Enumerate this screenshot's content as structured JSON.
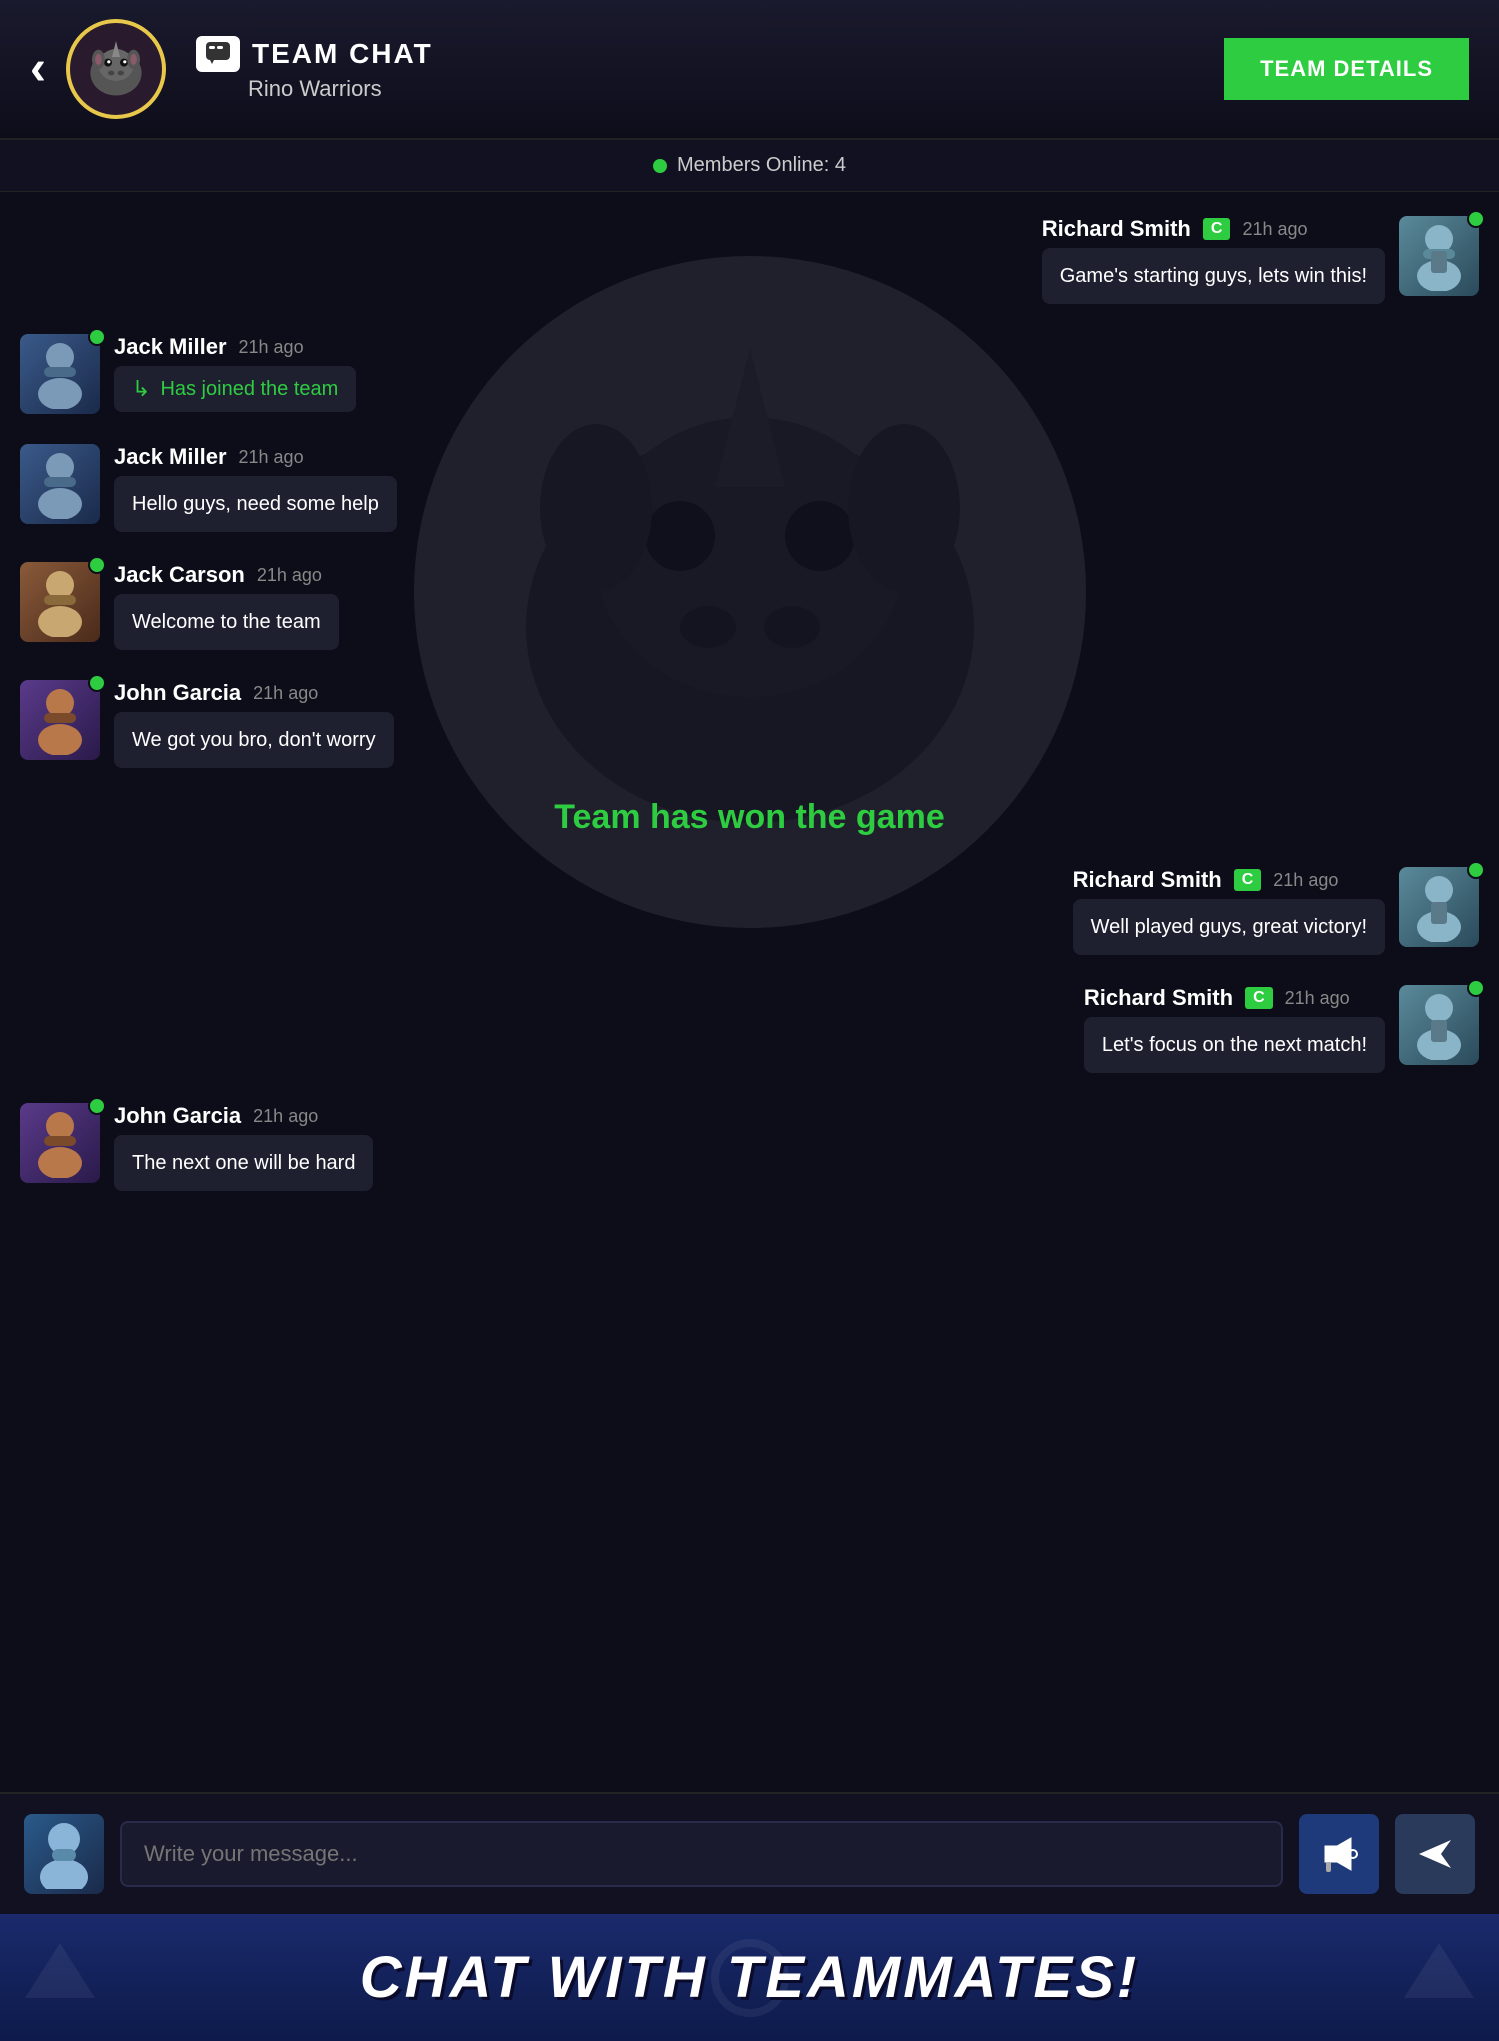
{
  "header": {
    "back_label": "‹",
    "chat_label": "TEAM CHAT",
    "team_name": "Rino Warriors",
    "team_details_label": "TEAM DETAILS"
  },
  "online_bar": {
    "label": "Members Online: 4"
  },
  "messages": [
    {
      "id": "msg1",
      "side": "right",
      "sender": "Richard Smith",
      "badge": "C",
      "time": "21h ago",
      "text": "Game's starting guys, lets win this!",
      "avatar_color": "av-richard",
      "online": true,
      "type": "normal"
    },
    {
      "id": "msg2",
      "side": "left",
      "sender": "Jack Miller",
      "badge": null,
      "time": "21h ago",
      "text": "Has joined the team",
      "avatar_color": "av-jack-miller",
      "online": true,
      "type": "join"
    },
    {
      "id": "msg3",
      "side": "left",
      "sender": "Jack Miller",
      "badge": null,
      "time": "21h ago",
      "text": "Hello guys, need some help",
      "avatar_color": "av-jack-miller",
      "online": false,
      "type": "normal"
    },
    {
      "id": "msg4",
      "side": "left",
      "sender": "Jack Carson",
      "badge": null,
      "time": "21h ago",
      "text": "Welcome to the team",
      "avatar_color": "av-jack-carson",
      "online": true,
      "type": "normal"
    },
    {
      "id": "msg5",
      "side": "left",
      "sender": "John Garcia",
      "badge": null,
      "time": "21h ago",
      "text": "We got you bro, don't worry",
      "avatar_color": "av-john-garcia",
      "online": true,
      "type": "normal"
    }
  ],
  "win_notification": "Team has won the game",
  "messages_after_win": [
    {
      "id": "msg6",
      "side": "right",
      "sender": "Richard Smith",
      "badge": "C",
      "time": "21h ago",
      "text": "Well played guys, great victory!",
      "avatar_color": "av-richard",
      "online": true,
      "type": "normal"
    },
    {
      "id": "msg7",
      "side": "right",
      "sender": "Richard Smith",
      "badge": "C",
      "time": "21h ago",
      "text": "Let's focus on the next match!",
      "avatar_color": "av-richard",
      "online": true,
      "type": "normal"
    },
    {
      "id": "msg8",
      "side": "left",
      "sender": "John Garcia",
      "badge": null,
      "time": "21h ago",
      "text": "The next one will be hard",
      "avatar_color": "av-john-garcia",
      "online": true,
      "type": "normal"
    }
  ],
  "input_bar": {
    "placeholder": "Write your message..."
  },
  "footer": {
    "text": "CHAT WITH TEAMMATES!"
  }
}
